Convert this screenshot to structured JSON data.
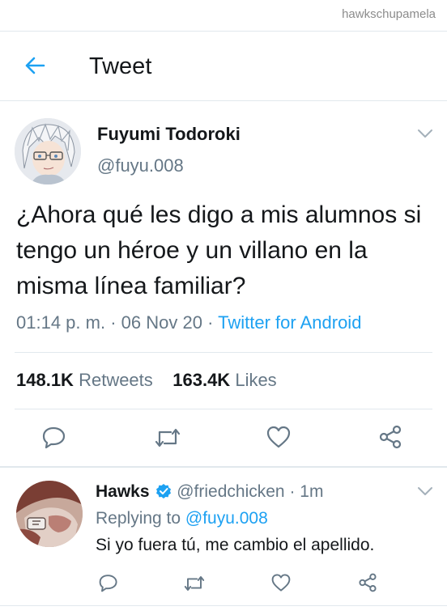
{
  "watermark": "hawkschupamela",
  "header": {
    "title": "Tweet"
  },
  "tweet": {
    "author_name": "Fuyumi Todoroki",
    "author_handle": "@fuyu.008",
    "text": "¿Ahora qué les digo a mis alumnos si tengo un héroe y un villano en la misma línea familiar?",
    "time": "01:14 p. m.",
    "separator": "·",
    "date": "06 Nov 20",
    "source": "Twitter for Android",
    "retweets_count": "148.1K",
    "retweets_label": "Retweets",
    "likes_count": "163.4K",
    "likes_label": "Likes"
  },
  "reply": {
    "author_name": "Hawks",
    "author_handle": "@friedchicken",
    "time_sep": "·",
    "time": "1m",
    "replying_prefix": "Replying to",
    "replying_handle": "@fuyu.008",
    "text": "Si yo fuera tú, me cambio el apellido."
  },
  "icons": {
    "back": "arrow-left-icon",
    "reply": "reply-icon",
    "retweet": "retweet-icon",
    "like": "heart-icon",
    "share": "share-icon",
    "verified": "verified-badge-icon",
    "caret": "chevron-down-icon"
  },
  "colors": {
    "accent": "#1da1f2",
    "muted": "#657786",
    "text": "#14171a",
    "divider": "#e1e8ed"
  }
}
